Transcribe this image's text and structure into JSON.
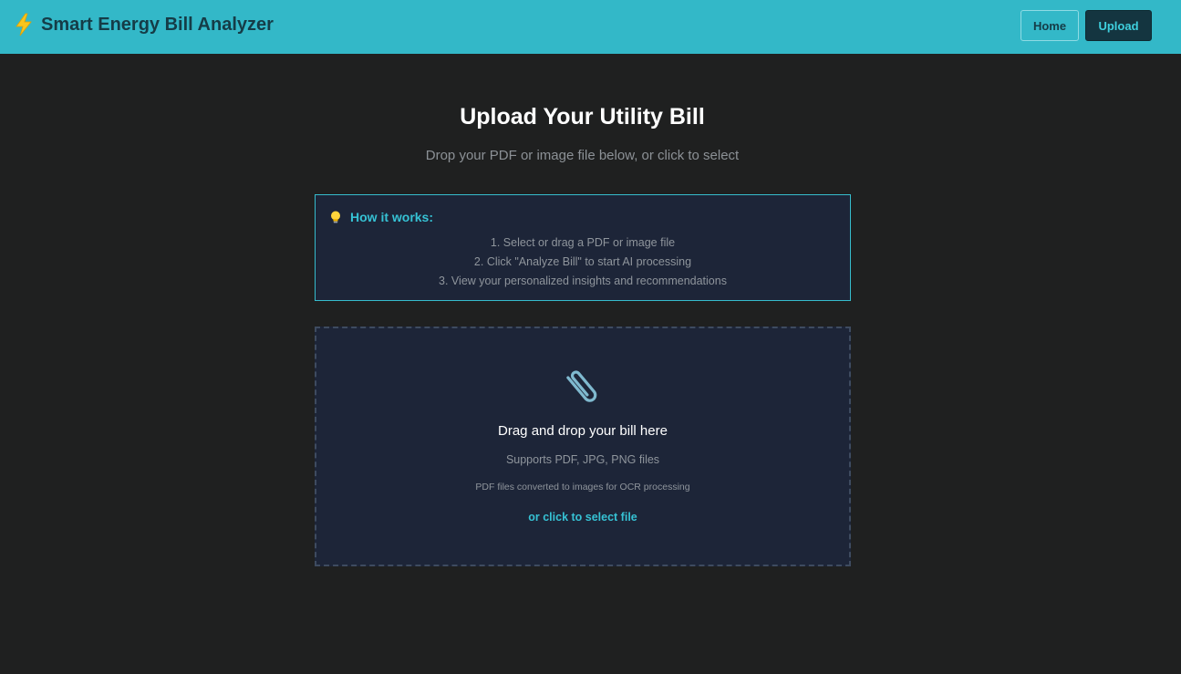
{
  "header": {
    "title": "Smart Energy Bill Analyzer",
    "brand_icon": "lightning-bolt-icon",
    "nav": {
      "home_label": "Home",
      "upload_label": "Upload"
    }
  },
  "main": {
    "title": "Upload Your Utility Bill",
    "subtitle": "Drop your PDF or image file below, or click to select"
  },
  "how_it_works": {
    "icon": "lightbulb-icon",
    "heading": "How it works:",
    "steps": [
      "1. Select or drag a PDF or image file",
      "2. Click \"Analyze Bill\" to start AI processing",
      "3. View your personalized insights and recommendations"
    ]
  },
  "dropzone": {
    "icon": "paperclip-icon",
    "title": "Drag and drop your bill here",
    "supports": "Supports PDF, JPG, PNG files",
    "note": "PDF files converted to images for OCR processing",
    "select_link": "or click to select file"
  },
  "colors": {
    "header_bg": "#33b8c8",
    "page_bg": "#1f2020",
    "panel_bg": "#1d2538",
    "accent": "#36c2d4"
  }
}
